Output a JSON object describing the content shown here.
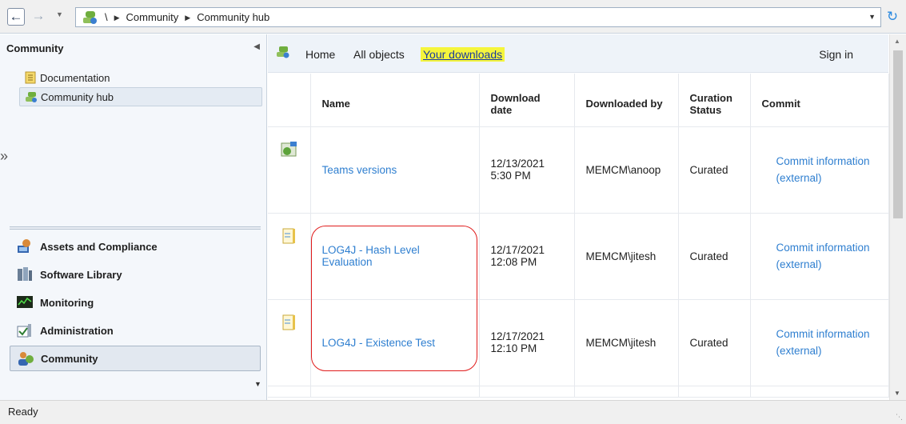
{
  "address": {
    "path": [
      "\\",
      "Community",
      "Community hub"
    ]
  },
  "left": {
    "title": "Community",
    "tree": [
      "Documentation",
      "Community hub"
    ],
    "workspaces": [
      "Assets and Compliance",
      "Software Library",
      "Monitoring",
      "Administration",
      "Community"
    ]
  },
  "nav": {
    "home": "Home",
    "all_objects": "All objects",
    "downloads": "Your downloads",
    "sign_in": "Sign in"
  },
  "table": {
    "headers": {
      "name": "Name",
      "download_date": "Download date",
      "downloaded_by": "Downloaded by",
      "curation_status": "Curation Status",
      "commit": "Commit"
    },
    "rows": [
      {
        "name": "Teams versions",
        "date": "12/13/2021",
        "time": "5:30 PM",
        "by": "MEMCM\\anoop",
        "status": "Curated",
        "commit": "Commit information (external)"
      },
      {
        "name": "LOG4J - Hash Level Evaluation",
        "date": "12/17/2021",
        "time": "12:08 PM",
        "by": "MEMCM\\jitesh",
        "status": "Curated",
        "commit": "Commit information (external)"
      },
      {
        "name": "LOG4J - Existence Test",
        "date": "12/17/2021",
        "time": "12:10 PM",
        "by": "MEMCM\\jitesh",
        "status": "Curated",
        "commit": "Commit information (external)"
      }
    ]
  },
  "status": {
    "text": "Ready"
  },
  "colors": {
    "link": "#2f7fd0",
    "highlight": "#f5f53c",
    "annotation": "#e01c1c"
  }
}
